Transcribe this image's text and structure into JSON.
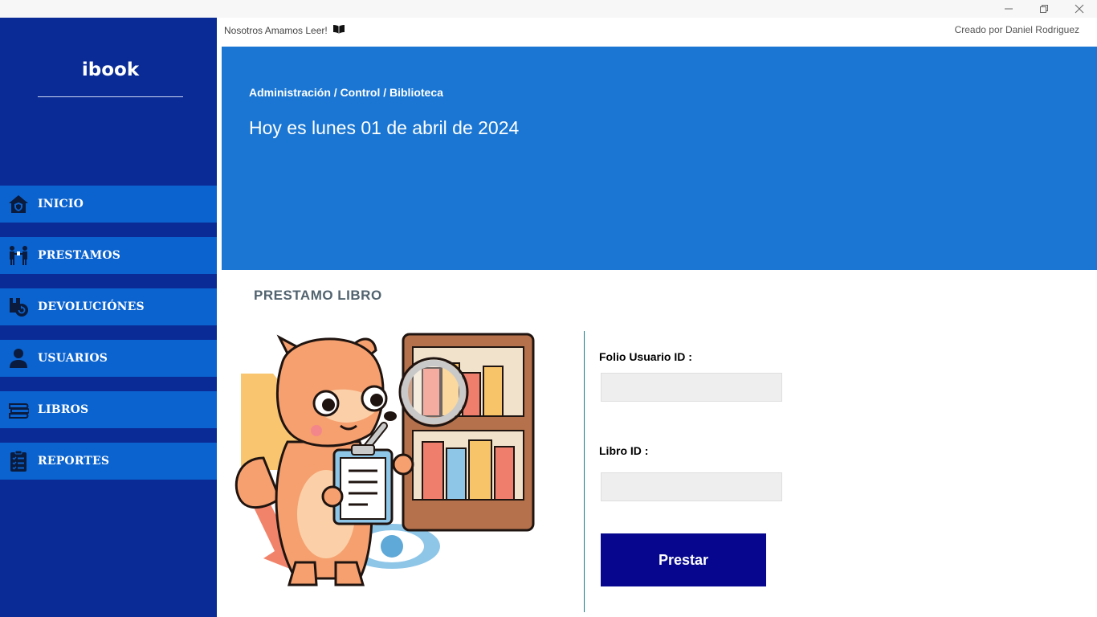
{
  "window": {
    "controls": [
      "minimize-icon",
      "restore-icon",
      "close-icon"
    ]
  },
  "sidebar": {
    "logo": "ibook",
    "items": [
      {
        "label": "INICIO",
        "icon": "home-icon"
      },
      {
        "label": "PRESTAMOS",
        "icon": "handover-icon"
      },
      {
        "label": "DEVOLUCIÓNES",
        "icon": "return-icon"
      },
      {
        "label": "USUARIOS",
        "icon": "user-icon"
      },
      {
        "label": "LIBROS",
        "icon": "books-icon"
      },
      {
        "label": "REPORTES",
        "icon": "clipboard-report-icon"
      }
    ]
  },
  "header": {
    "tagline": "Nosotros Amamos Leer!",
    "tagline_icon": "open-book-icon",
    "credit": "Creado por Daniel Rodriguez"
  },
  "banner": {
    "breadcrumb": "Administración / Control / Biblioteca",
    "date": "Hoy es lunes 01 de abril de 2024"
  },
  "main": {
    "title": "PRESTAMO  LIBRO",
    "fields": [
      {
        "label": "Folio Usuario ID :",
        "value": "",
        "placeholder": ""
      },
      {
        "label": "Libro ID :",
        "value": "",
        "placeholder": ""
      }
    ],
    "submit_label": "Prestar"
  },
  "colors": {
    "sidebar_bg": "#0a2b96",
    "nav_item_bg": "#0b63cf",
    "banner_bg": "#1a76d2",
    "button_bg": "#06078e",
    "title_text": "#51636f"
  }
}
